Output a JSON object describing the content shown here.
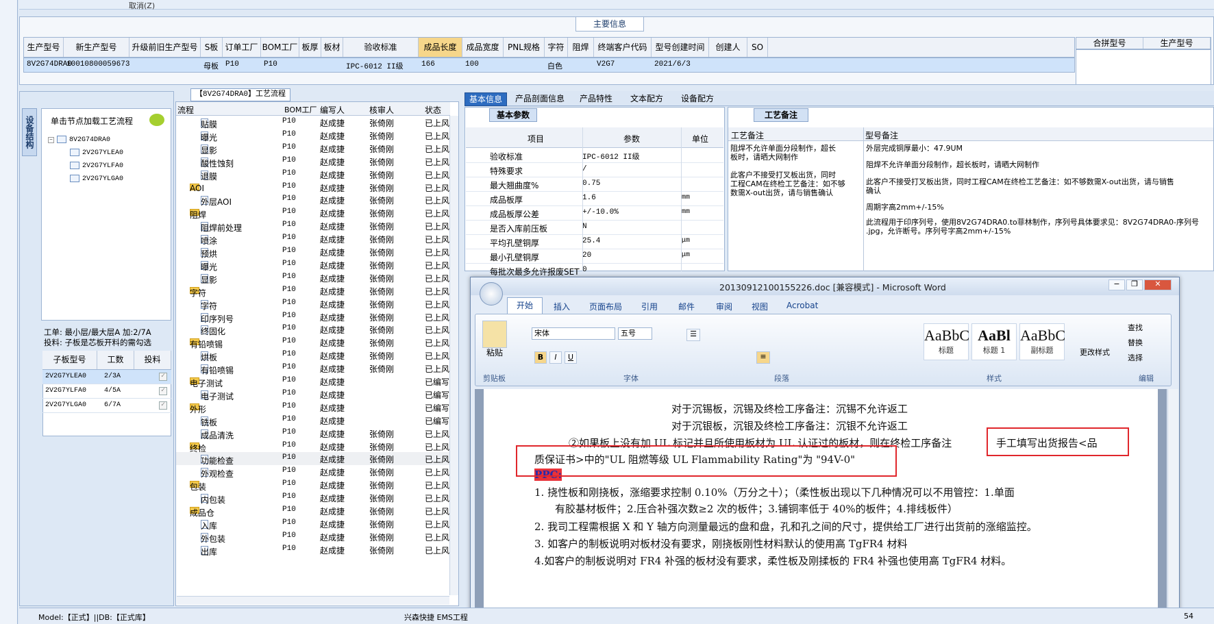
{
  "top": {
    "cancel": "取消(Z)",
    "main_info": "主要信息"
  },
  "grid": {
    "headers": [
      "生产型号",
      "新生产型号",
      "升级前旧生产型号",
      "S板",
      "订单工厂",
      "BOM工厂",
      "板厚",
      "板材",
      "验收标准",
      "成品长度",
      "成品宽度",
      "PNL规格",
      "字符",
      "阻焊",
      "终端客户代码",
      "型号创建时间",
      "创建人",
      "SO"
    ],
    "row": [
      "8V2G74DRA0",
      "10010800059673",
      "",
      "母板",
      "P10",
      "P10",
      "",
      "",
      "IPC-6012 II级",
      "166",
      "100",
      "",
      "白色",
      "",
      "V2G7",
      "2021/6/3",
      "",
      ""
    ],
    "right_headers": [
      "合拼型号",
      "生产型号"
    ]
  },
  "left": {
    "vtab": "设备结构",
    "tree_title": "单击节点加载工艺流程",
    "tree": [
      "8V2G74DRA0",
      "2V2G7YLEA0",
      "2V2G7YLFA0",
      "2V2G7YLGA0"
    ],
    "info1": "工单: 最小层/最大层A  加:2/7A",
    "info2": "投料: 子板是芯板开料的需勾选",
    "sub_headers": [
      "子板型号",
      "工数",
      "投料"
    ],
    "sub_rows": [
      [
        "2V2G7YLEA0",
        "2/3A"
      ],
      [
        "2V2G7YLFA0",
        "4/5A"
      ],
      [
        "2V2G7YLGA0",
        "6/7A"
      ]
    ]
  },
  "process": {
    "title": "【8V2G74DRA0】工艺流程",
    "headers": [
      "流程",
      "BOM工厂",
      "编写人",
      "核审人",
      "状态"
    ],
    "rows": [
      {
        "n": "贴膜",
        "lvl": 2,
        "f": false,
        "b": "P10",
        "w": "赵成捷",
        "r": "张倚刚",
        "s": "已上风"
      },
      {
        "n": "曝光",
        "lvl": 2,
        "f": false,
        "b": "P10",
        "w": "赵成捷",
        "r": "张倚刚",
        "s": "已上风"
      },
      {
        "n": "显影",
        "lvl": 2,
        "f": false,
        "b": "P10",
        "w": "赵成捷",
        "r": "张倚刚",
        "s": "已上风"
      },
      {
        "n": "酸性蚀刻",
        "lvl": 2,
        "f": false,
        "b": "P10",
        "w": "赵成捷",
        "r": "张倚刚",
        "s": "已上风"
      },
      {
        "n": "退膜",
        "lvl": 2,
        "f": false,
        "b": "P10",
        "w": "赵成捷",
        "r": "张倚刚",
        "s": "已上风"
      },
      {
        "n": "AOI",
        "lvl": 1,
        "f": true,
        "b": "P10",
        "w": "赵成捷",
        "r": "张倚刚",
        "s": "已上风"
      },
      {
        "n": "外层AOI",
        "lvl": 2,
        "f": false,
        "b": "P10",
        "w": "赵成捷",
        "r": "张倚刚",
        "s": "已上风"
      },
      {
        "n": "阻焊",
        "lvl": 1,
        "f": true,
        "b": "P10",
        "w": "赵成捷",
        "r": "张倚刚",
        "s": "已上风"
      },
      {
        "n": "阻焊前处理",
        "lvl": 2,
        "f": false,
        "b": "P10",
        "w": "赵成捷",
        "r": "张倚刚",
        "s": "已上风"
      },
      {
        "n": "喷涂",
        "lvl": 2,
        "f": false,
        "b": "P10",
        "w": "赵成捷",
        "r": "张倚刚",
        "s": "已上风"
      },
      {
        "n": "预烘",
        "lvl": 2,
        "f": false,
        "b": "P10",
        "w": "赵成捷",
        "r": "张倚刚",
        "s": "已上风"
      },
      {
        "n": "曝光",
        "lvl": 2,
        "f": false,
        "b": "P10",
        "w": "赵成捷",
        "r": "张倚刚",
        "s": "已上风"
      },
      {
        "n": "显影",
        "lvl": 2,
        "f": false,
        "b": "P10",
        "w": "赵成捷",
        "r": "张倚刚",
        "s": "已上风"
      },
      {
        "n": "字符",
        "lvl": 1,
        "f": true,
        "b": "P10",
        "w": "赵成捷",
        "r": "张倚刚",
        "s": "已上风"
      },
      {
        "n": "字符",
        "lvl": 2,
        "f": false,
        "b": "P10",
        "w": "赵成捷",
        "r": "张倚刚",
        "s": "已上风"
      },
      {
        "n": "印序列号",
        "lvl": 2,
        "f": false,
        "b": "P10",
        "w": "赵成捷",
        "r": "张倚刚",
        "s": "已上风"
      },
      {
        "n": "终固化",
        "lvl": 2,
        "f": false,
        "b": "P10",
        "w": "赵成捷",
        "r": "张倚刚",
        "s": "已上风"
      },
      {
        "n": "有铅喷锡",
        "lvl": 1,
        "f": true,
        "b": "P10",
        "w": "赵成捷",
        "r": "张倚刚",
        "s": "已上风"
      },
      {
        "n": "烘板",
        "lvl": 2,
        "f": false,
        "b": "P10",
        "w": "赵成捷",
        "r": "张倚刚",
        "s": "已上风"
      },
      {
        "n": "有铅喷锡",
        "lvl": 2,
        "f": false,
        "b": "P10",
        "w": "赵成捷",
        "r": "张倚刚",
        "s": "已上风"
      },
      {
        "n": "电子测试",
        "lvl": 1,
        "f": true,
        "b": "P10",
        "w": "赵成捷",
        "r": "",
        "s": "已编写"
      },
      {
        "n": "电子测试",
        "lvl": 2,
        "f": false,
        "b": "P10",
        "w": "赵成捷",
        "r": "",
        "s": "已编写"
      },
      {
        "n": "外形",
        "lvl": 1,
        "f": true,
        "b": "P10",
        "w": "赵成捷",
        "r": "",
        "s": "已编写"
      },
      {
        "n": "铣板",
        "lvl": 2,
        "f": false,
        "b": "P10",
        "w": "赵成捷",
        "r": "",
        "s": "已编写"
      },
      {
        "n": "成品清洗",
        "lvl": 2,
        "f": false,
        "b": "P10",
        "w": "赵成捷",
        "r": "张倚刚",
        "s": "已上风"
      },
      {
        "n": "终检",
        "lvl": 1,
        "f": true,
        "b": "P10",
        "w": "赵成捷",
        "r": "张倚刚",
        "s": "已上风"
      },
      {
        "n": "功能检查",
        "lvl": 2,
        "f": false,
        "b": "P10",
        "w": "赵成捷",
        "r": "张倚刚",
        "s": "已上风"
      },
      {
        "n": "外观检查",
        "lvl": 2,
        "f": false,
        "b": "P10",
        "w": "赵成捷",
        "r": "张倚刚",
        "s": "已上风"
      },
      {
        "n": "包装",
        "lvl": 1,
        "f": true,
        "b": "P10",
        "w": "赵成捷",
        "r": "张倚刚",
        "s": "已上风"
      },
      {
        "n": "内包装",
        "lvl": 2,
        "f": false,
        "b": "P10",
        "w": "赵成捷",
        "r": "张倚刚",
        "s": "已上风"
      },
      {
        "n": "成品仓",
        "lvl": 1,
        "f": true,
        "b": "P10",
        "w": "赵成捷",
        "r": "张倚刚",
        "s": "已上风"
      },
      {
        "n": "入库",
        "lvl": 2,
        "f": false,
        "b": "P10",
        "w": "赵成捷",
        "r": "张倚刚",
        "s": "已上风"
      },
      {
        "n": "外包装",
        "lvl": 2,
        "f": false,
        "b": "P10",
        "w": "赵成捷",
        "r": "张倚刚",
        "s": "已上风"
      },
      {
        "n": "出库",
        "lvl": 2,
        "f": false,
        "b": "P10",
        "w": "赵成捷",
        "r": "张倚刚",
        "s": "已上风"
      }
    ]
  },
  "tabs": [
    "基本信息",
    "产品剖面信息",
    "产品特性",
    "文本配方",
    "设备配方"
  ],
  "basic": {
    "title": "基本参数",
    "headers": [
      "项目",
      "参数",
      "单位"
    ],
    "rows": [
      [
        "验收标准",
        "IPC-6012 II级",
        ""
      ],
      [
        "特殊要求",
        "/",
        ""
      ],
      [
        "最大翘曲度%",
        "0.75",
        ""
      ],
      [
        "成品板厚",
        "1.6",
        "mm"
      ],
      [
        "成品板厚公差",
        "+/-10.0%",
        "mm"
      ],
      [
        "是否入库前压板",
        "N",
        ""
      ],
      [
        "平均孔壁铜厚",
        "25.4",
        "μm"
      ],
      [
        "最小孔壁铜厚",
        "20",
        "μm"
      ],
      [
        "每批次最多允许报废SET",
        "0",
        ""
      ]
    ]
  },
  "craft": {
    "title": "工艺备注",
    "col1": "工艺备注",
    "col2": "型号备注",
    "note1": "阻焊不允许单面分段制作，超长\n板时，请晒大网制作\n\n此客户不接受打叉板出货，同时\n工程CAM在终检工艺备注：如不够\n数需X-out出货，请与销售确认",
    "note2a": "外层完成铜厚最小：47.9UM",
    "note2b": "阻焊不允许单面分段制作，超长板时，请晒大网制作",
    "note2c": "此客户不接受打叉板出货，同时工程CAM在终检工艺备注：如不够数需X-out出货，请与销售\n确认",
    "note2d": "周期字高2mm+/-15%",
    "note2e": "此流程用于印序列号，使用8V2G74DRA0.to菲林制作，序列号具体要求见：8V2G74DRA0-序列号\n.jpg，允许断号。序列号字高2mm+/-15%"
  },
  "word": {
    "title": "20130912100155226.doc [兼容模式] - Microsoft Word",
    "tabs": [
      "开始",
      "插入",
      "页面布局",
      "引用",
      "邮件",
      "审阅",
      "视图",
      "Acrobat"
    ],
    "font": "宋体",
    "size": "五号",
    "groups": [
      "剪贴板",
      "字体",
      "段落",
      "样式",
      "编辑"
    ],
    "paste": "粘贴",
    "styles": [
      "标题",
      "标题 1",
      "副标题"
    ],
    "change_style": "更改样式",
    "find": "查找",
    "replace": "替换",
    "select": "选择",
    "lines": [
      "对于沉锡板，沉锡及终检工序备注：沉锡不允许返工",
      "对于沉银板，沉银及终检工序备注：沉银不允许返工",
      "②如果板上没有加 UL 标记并且所使用板材为 UL 认证过的板材，则在终检工序备注",
      "手工填写出货报告<品",
      "质保证书>中的\"UL 阻燃等级 UL Flammability Rating\"为 \"94V-0\"",
      "PPC:",
      "1.  挠性板和刚挠板，涨缩要求控制  0.10%（万分之十）；（柔性板出现以下几种情况可以不用管控：1.单面",
      "有胶基材板件；2.压合补强次数≥2 次的板件；3.铺铜率低于 40%的板件；4.排线板件）",
      "2.   我司工程需根据 X 和 Y 轴方向测量最远的盘和盘，孔和孔之间的尺寸，提供给工厂进行出货前的涨缩监控。",
      "3. 如客户的制板说明对板材没有要求，刚挠板刚性材料默认的使用高 TgFR4 材料",
      "4.如客户的制板说明对 FR4 补强的板材没有要求，柔性板及刚揉板的 FR4 补强也使用高 TgFR4 材料。"
    ]
  },
  "status": {
    "model": "Model:【正式】||DB:【正式库】",
    "app": "兴森快捷 EMS工程",
    "num": "54"
  }
}
